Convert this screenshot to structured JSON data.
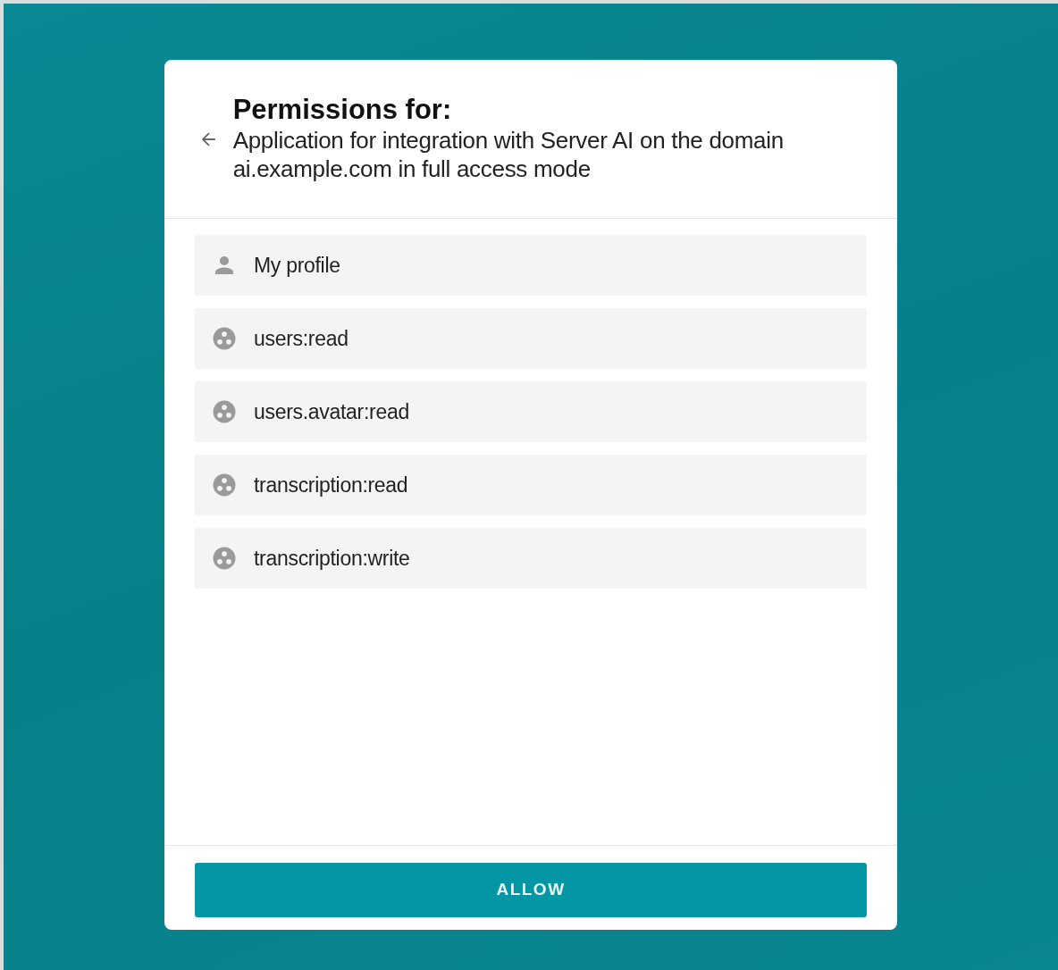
{
  "header": {
    "title": "Permissions for:",
    "subtitle": "Application for integration with Server AI on the domain ai.example.com in full access mode"
  },
  "permissions": [
    {
      "kind": "profile",
      "label": "My profile"
    },
    {
      "kind": "scope",
      "label": "users:read"
    },
    {
      "kind": "scope",
      "label": "users.avatar:read"
    },
    {
      "kind": "scope",
      "label": "transcription:read"
    },
    {
      "kind": "scope",
      "label": "transcription:write"
    }
  ],
  "button": {
    "label": "ALLOW"
  }
}
